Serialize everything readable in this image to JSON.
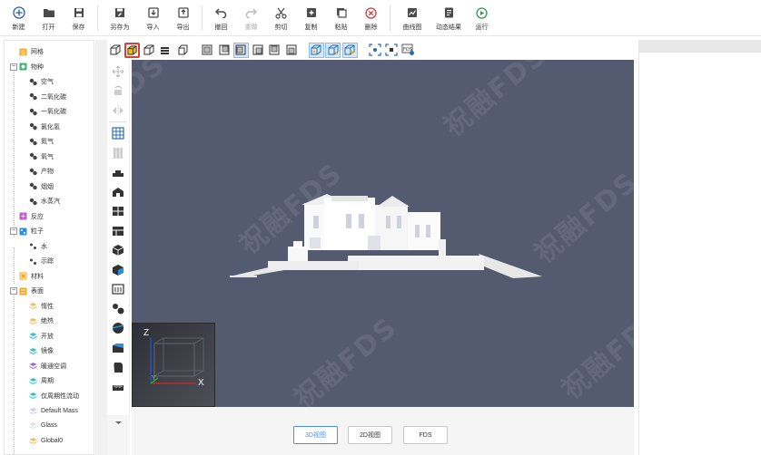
{
  "toolbar": {
    "new": "新建",
    "open": "打开",
    "save": "保存",
    "save_as": "另存为",
    "import": "导入",
    "export": "导出",
    "undo": "撤回",
    "redo": "重做",
    "cut": "剪切",
    "copy": "复制",
    "paste": "粘贴",
    "delete": "删除",
    "curve": "曲线图",
    "animation": "动态结果",
    "run": "运行"
  },
  "tree": {
    "mesh": "网格",
    "species": "物种",
    "air": "空气",
    "co2": "二氧化碳",
    "co": "一氧化碳",
    "hcl": "氯化氢",
    "n2": "氮气",
    "o2": "氧气",
    "product": "产物",
    "soot": "烟烟",
    "vapor": "水蒸汽",
    "reaction": "反应",
    "particle": "粒子",
    "water": "水",
    "tracer": "示踪",
    "material": "材料",
    "surface": "表面",
    "inert": "惰性",
    "adiabatic": "绝热",
    "open": "开放",
    "mirror": "镜像",
    "hvac": "暖通空调",
    "periodic": "周期",
    "periodic_flow": "仅周期性流动",
    "default_mass": "Default Mass",
    "glass": "Glass",
    "global": "Global0"
  },
  "viewport": {
    "watermark": "祝融FDS",
    "axis_x": "X",
    "axis_y": "Y",
    "axis_z": "Z"
  },
  "tabs": {
    "view3d": "3D视图",
    "view2d": "2D视图",
    "fds": "FDS"
  },
  "colors": {
    "viewport_bg": "#545a70",
    "accent": "#4a90e2",
    "selected_border": "#e53935"
  }
}
